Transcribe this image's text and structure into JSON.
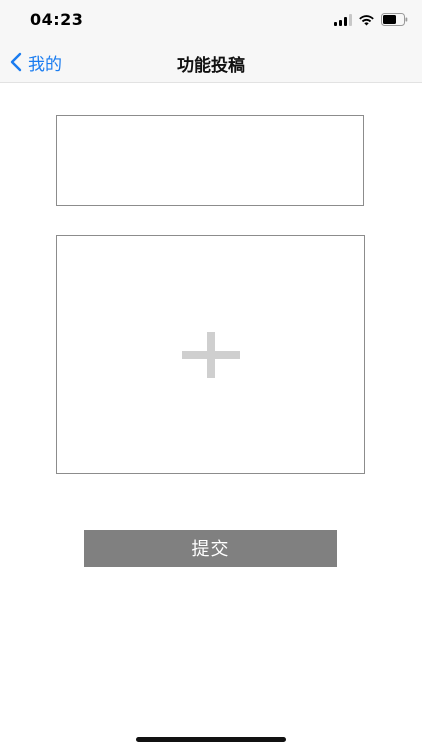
{
  "status_bar": {
    "time": "04:23",
    "signal_icon": "signal-icon",
    "wifi_icon": "wifi-icon",
    "battery_icon": "battery-icon"
  },
  "nav": {
    "back_label": "我的",
    "back_icon": "chevron-left-icon",
    "title": "功能投稿"
  },
  "form": {
    "title_input_value": "",
    "image_picker_icon": "plus-icon",
    "submit_label": "提交"
  },
  "colors": {
    "accent": "#1a7cf0",
    "submit_bg": "#808080",
    "bar_bg": "#f7f7f7"
  }
}
